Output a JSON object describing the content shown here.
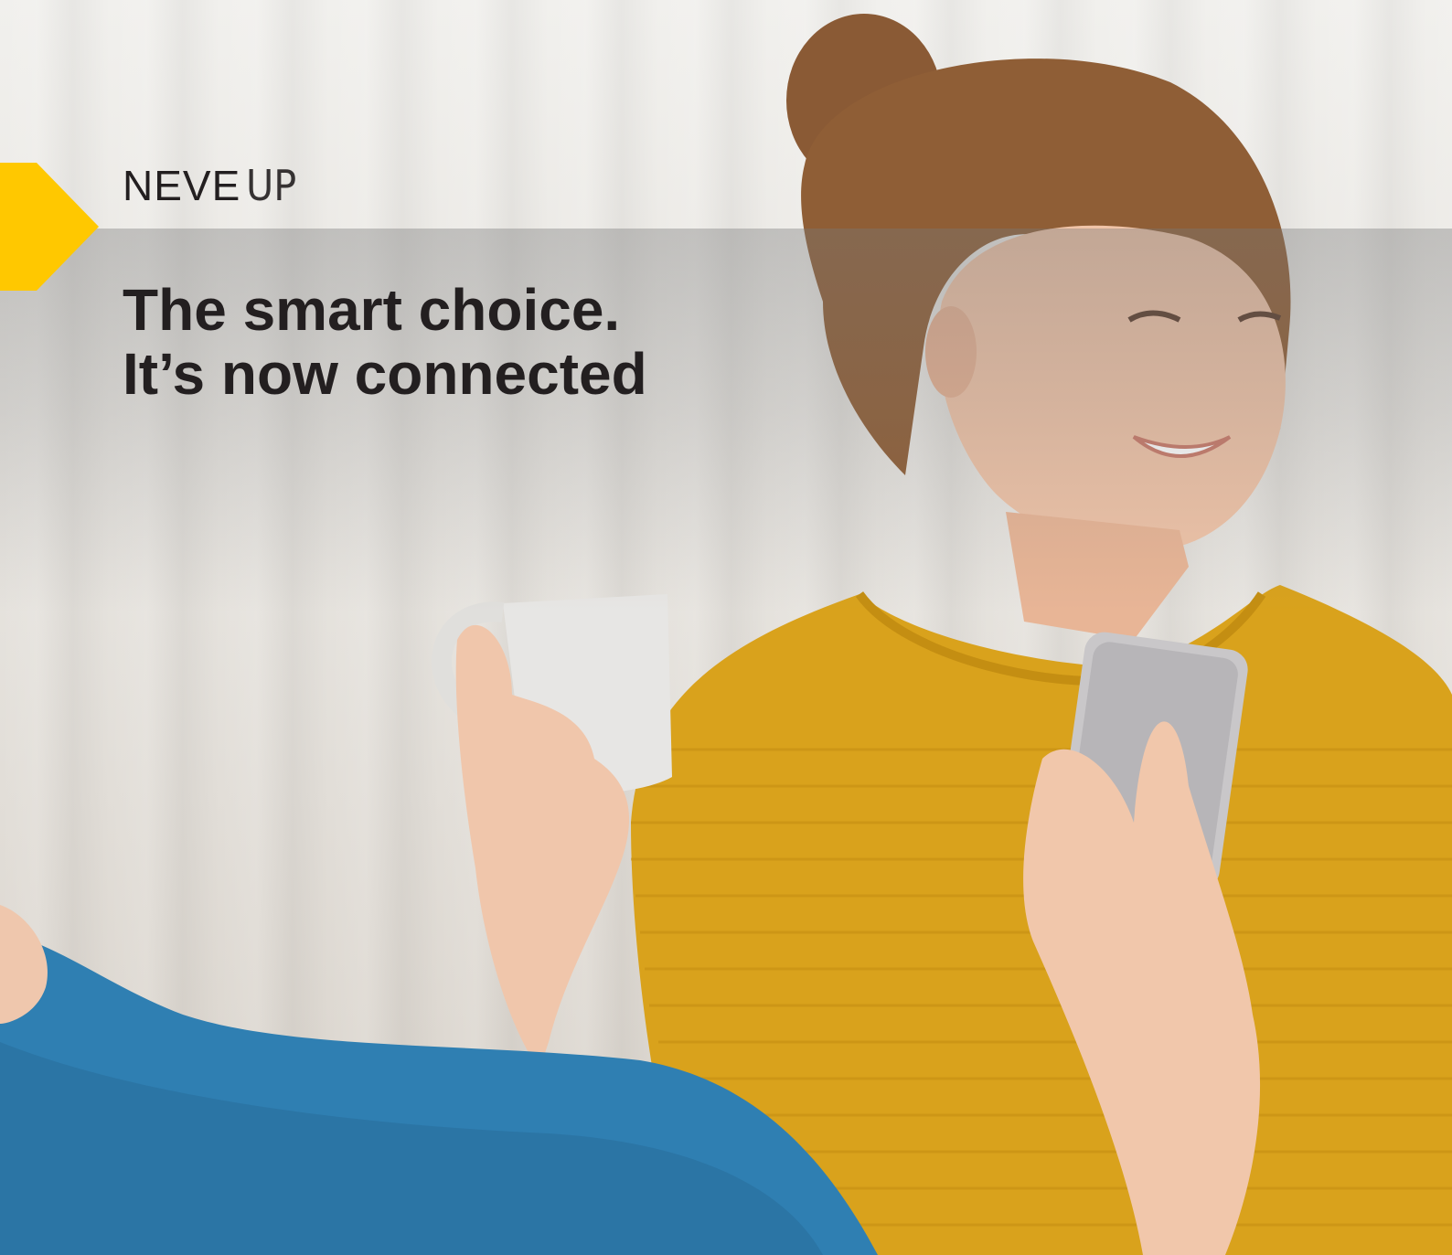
{
  "brand": {
    "name_bold": "NEVE",
    "name_light": "UP",
    "accent_color": "#ffc800"
  },
  "headline": {
    "line1": "The smart choice.",
    "line2": "It’s now connected"
  },
  "photo": {
    "icons": [
      "coffee-mug-icon",
      "smartphone-icon"
    ]
  }
}
